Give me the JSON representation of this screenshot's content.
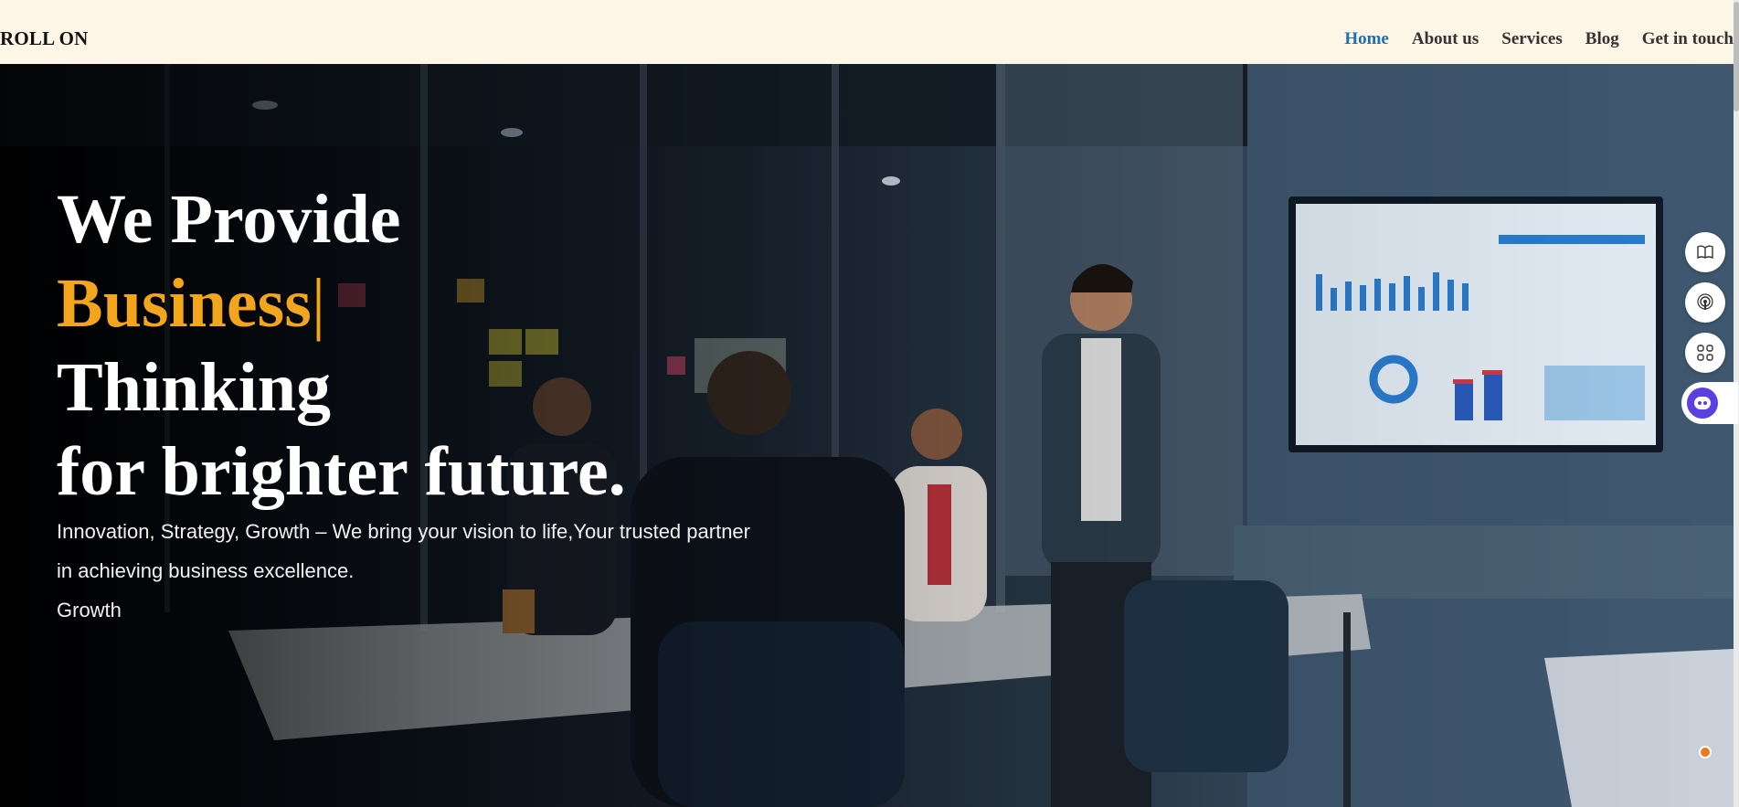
{
  "header": {
    "brand": "ROLL ON",
    "nav": [
      "Home",
      "About us",
      "Services",
      "Blog",
      "Get in touch"
    ],
    "active": "Home"
  },
  "hero": {
    "line1": "We Provide",
    "line2_accent": "Business",
    "line2_cursor": "|",
    "line3": "Thinking",
    "line4": "for brighter future.",
    "subtitle": "Innovation, Strategy, Growth – We bring your vision to life,Your trusted partner in achieving business excellence.",
    "subtitle2": "Growth"
  },
  "floating_widgets": {
    "icons": [
      "book-icon",
      "podcast-icon",
      "apps-icon",
      "assistant-icon",
      "status-dot"
    ]
  },
  "colors": {
    "header_bg": "#fdf6e7",
    "nav_active": "#1f6fb0",
    "accent": "#f3a51b",
    "assistant": "#5b3fe0",
    "status_dot": "#f07a1a"
  }
}
